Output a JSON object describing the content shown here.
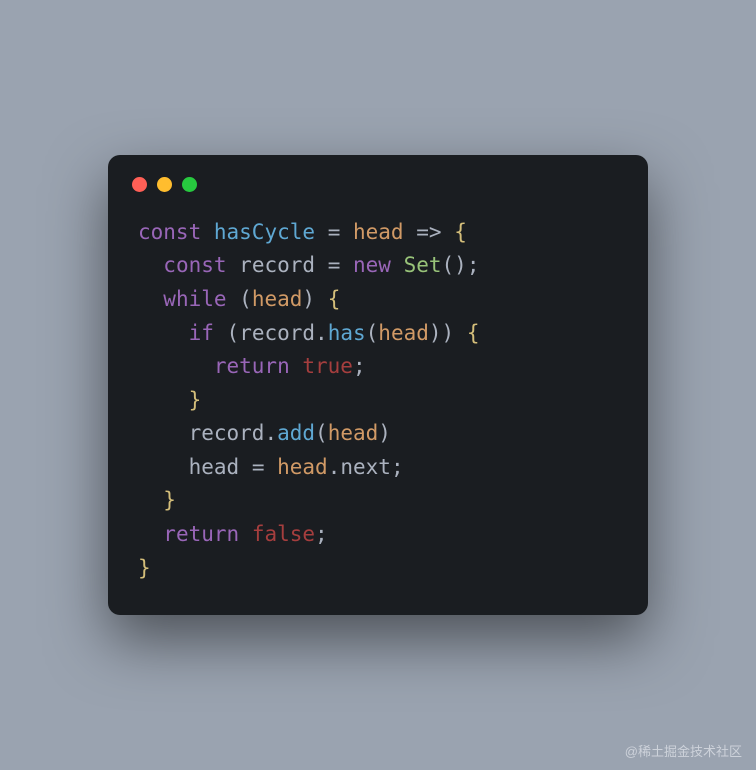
{
  "window": {
    "traffic_lights": {
      "red": "#ff5f56",
      "yellow": "#ffbd2e",
      "green": "#27c93f"
    }
  },
  "code": {
    "lines": [
      [
        {
          "cls": "kw",
          "text": "const"
        },
        {
          "cls": "op",
          "text": " "
        },
        {
          "cls": "fn",
          "text": "hasCycle"
        },
        {
          "cls": "op",
          "text": " "
        },
        {
          "cls": "eq",
          "text": "="
        },
        {
          "cls": "op",
          "text": " "
        },
        {
          "cls": "param",
          "text": "head"
        },
        {
          "cls": "op",
          "text": " "
        },
        {
          "cls": "eq",
          "text": "=>"
        },
        {
          "cls": "op",
          "text": " "
        },
        {
          "cls": "brace",
          "text": "{"
        }
      ],
      [
        {
          "cls": "op",
          "text": "  "
        },
        {
          "cls": "kw",
          "text": "const"
        },
        {
          "cls": "op",
          "text": " "
        },
        {
          "cls": "var",
          "text": "record"
        },
        {
          "cls": "op",
          "text": " "
        },
        {
          "cls": "eq",
          "text": "="
        },
        {
          "cls": "op",
          "text": " "
        },
        {
          "cls": "new",
          "text": "new"
        },
        {
          "cls": "op",
          "text": " "
        },
        {
          "cls": "cls",
          "text": "Set"
        },
        {
          "cls": "punc",
          "text": "();"
        }
      ],
      [
        {
          "cls": "op",
          "text": "  "
        },
        {
          "cls": "kw",
          "text": "while"
        },
        {
          "cls": "op",
          "text": " "
        },
        {
          "cls": "punc",
          "text": "("
        },
        {
          "cls": "param",
          "text": "head"
        },
        {
          "cls": "punc",
          "text": ") "
        },
        {
          "cls": "brace",
          "text": "{"
        }
      ],
      [
        {
          "cls": "op",
          "text": "    "
        },
        {
          "cls": "kw",
          "text": "if"
        },
        {
          "cls": "op",
          "text": " "
        },
        {
          "cls": "punc",
          "text": "("
        },
        {
          "cls": "var",
          "text": "record"
        },
        {
          "cls": "punc",
          "text": "."
        },
        {
          "cls": "method",
          "text": "has"
        },
        {
          "cls": "punc",
          "text": "("
        },
        {
          "cls": "param",
          "text": "head"
        },
        {
          "cls": "punc",
          "text": ")) "
        },
        {
          "cls": "brace",
          "text": "{"
        }
      ],
      [
        {
          "cls": "op",
          "text": "      "
        },
        {
          "cls": "kw",
          "text": "return"
        },
        {
          "cls": "op",
          "text": " "
        },
        {
          "cls": "bool",
          "text": "true"
        },
        {
          "cls": "punc",
          "text": ";"
        }
      ],
      [
        {
          "cls": "op",
          "text": "    "
        },
        {
          "cls": "brace",
          "text": "}"
        }
      ],
      [
        {
          "cls": "op",
          "text": "    "
        },
        {
          "cls": "var",
          "text": "record"
        },
        {
          "cls": "punc",
          "text": "."
        },
        {
          "cls": "method",
          "text": "add"
        },
        {
          "cls": "punc",
          "text": "("
        },
        {
          "cls": "param",
          "text": "head"
        },
        {
          "cls": "punc",
          "text": ")"
        }
      ],
      [
        {
          "cls": "op",
          "text": "    "
        },
        {
          "cls": "var",
          "text": "head"
        },
        {
          "cls": "op",
          "text": " "
        },
        {
          "cls": "eq",
          "text": "="
        },
        {
          "cls": "op",
          "text": " "
        },
        {
          "cls": "param",
          "text": "head"
        },
        {
          "cls": "punc",
          "text": "."
        },
        {
          "cls": "prop",
          "text": "next"
        },
        {
          "cls": "punc",
          "text": ";"
        }
      ],
      [
        {
          "cls": "op",
          "text": "  "
        },
        {
          "cls": "brace",
          "text": "}"
        }
      ],
      [
        {
          "cls": "op",
          "text": "  "
        },
        {
          "cls": "kw",
          "text": "return"
        },
        {
          "cls": "op",
          "text": " "
        },
        {
          "cls": "bool",
          "text": "false"
        },
        {
          "cls": "punc",
          "text": ";"
        }
      ],
      [
        {
          "cls": "brace",
          "text": "}"
        }
      ]
    ]
  },
  "watermark": "@稀土掘金技术社区"
}
